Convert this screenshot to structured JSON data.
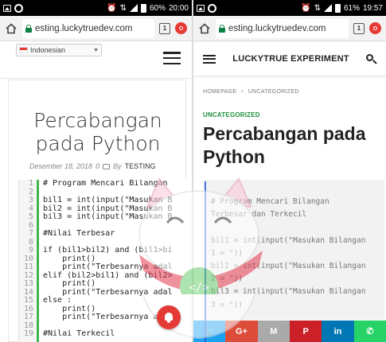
{
  "left": {
    "status": {
      "battery": "60%",
      "time": "20:00"
    },
    "url": "esting.luckytruedev.com",
    "tab_count": "1",
    "language": "Indonesian",
    "title": "Percabangan pada Python",
    "meta": {
      "date": "Desember 18, 2018",
      "comments": "0",
      "by": "By",
      "author": "TESTING"
    },
    "code_line_numbers": "1\n2\n3\n4\n5\n6\n7\n8\n9\n10\n11\n12\n13\n14\n15\n16\n17\n18\n19",
    "code": "# Program Mencari Bilangan\n\nbil1 = int(input(\"Masukan B\nbil2 = int(input(\"Masukan B\nbil3 = int(input(\"Masukan B\n\n#Nilai Terbesar\n\nif (bil1>bil2) and (bil1>bi\n    print()\n    print(\"Terbesarnya adal\nelif (bil2>bil1) and (bil2>\n    print()\n    print(\"Terbesarnya adal\nelse :\n    print()\n    print(\"Terbesarnya ada\n\n#Nilai Terkecil"
  },
  "right": {
    "status": {
      "battery": "61%",
      "time": "19:57"
    },
    "url": "esting.luckytruedev.com",
    "tab_count": "1",
    "site_title": "LUCKYTRUE EXPERIMENT",
    "breadcrumb": {
      "home": "HOMEPAGE",
      "sep": ">",
      "current": "UNCATEGORIZED"
    },
    "category": "UNCATEGORIZED",
    "title": "Percabangan pada Python",
    "code": "# Program Mencari Bilangan\nTerbesar dan Terkecil\n\nbil1 = int(input(\"Masukan Bilangan\n1 = \"))\nbil2 = int(input(\"Masukan Bilangan\n2 = \"))\nbil3 = int(input(\"Masukan Bilangan\n3 = \"))",
    "share": [
      {
        "name": "twitter",
        "glyph": "🐦"
      },
      {
        "name": "gplus",
        "glyph": "G+"
      },
      {
        "name": "gmail",
        "glyph": "M"
      },
      {
        "name": "pinterest",
        "glyph": "P"
      },
      {
        "name": "linkedin",
        "glyph": "in"
      },
      {
        "name": "whatsapp",
        "glyph": "✆"
      }
    ]
  },
  "colors": {
    "code_bar": "#3cb54a",
    "category": "#1e8e3e",
    "twitter": "#1da1f2",
    "gplus": "#dd4b39",
    "gmail": "#aaaaaa",
    "pinterest": "#cb2027",
    "linkedin": "#0077b5",
    "whatsapp": "#25d366",
    "notify": "#e53935"
  },
  "icons": {
    "home": "home-icon",
    "lock": "lock-icon",
    "tabs": "tab-switcher-icon",
    "vpn": "vpn-icon",
    "menu": "hamburger-icon",
    "search": "search-icon",
    "comment": "comment-icon",
    "bell": "bell-icon",
    "mascot": "lucky-cat-mascot"
  }
}
